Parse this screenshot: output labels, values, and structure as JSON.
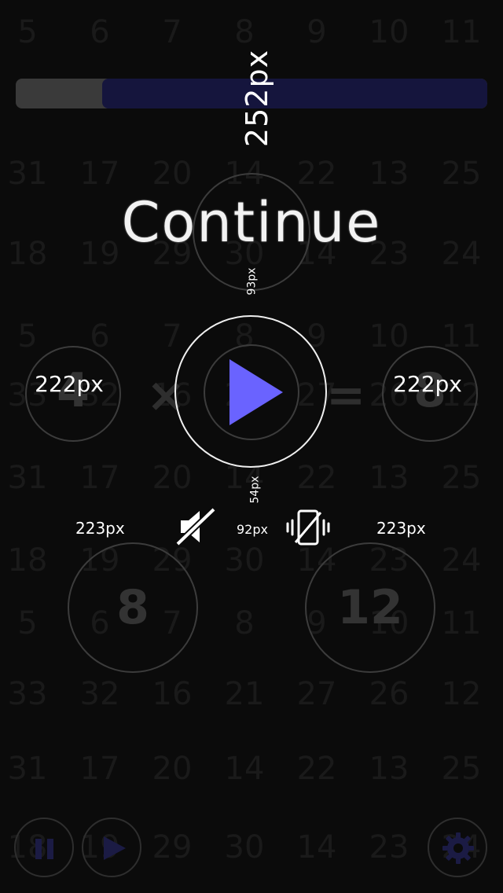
{
  "progress": {
    "fraction": 0.817
  },
  "labels": {
    "progress_px": "252px",
    "continue": "Continue",
    "top_circle_px": "93px",
    "left_circle_px": "222px",
    "right_circle_px": "222px",
    "play_below_px": "54px",
    "left_bottom_px": "223px",
    "right_bottom_px": "223px",
    "center_small_px": "92px"
  },
  "game": {
    "left_operand": "4",
    "operator": "×",
    "equals": "=",
    "right_result": "8",
    "option_left": "8",
    "option_right": "12"
  },
  "colors": {
    "accent": "#6a63ff",
    "progress_fill": "#15153d",
    "progress_track": "#3a3a3a",
    "background": "#0b0b0b",
    "bottom_icons": "#1b1b44"
  },
  "icons": {
    "mute": "speaker-muted-icon",
    "vibrate": "vibrate-off-icon",
    "play": "play-icon",
    "pause": "pause-icon",
    "settings": "gear-icon"
  },
  "background_grid": [
    [
      "5",
      "6",
      "7",
      "8",
      "9",
      "10",
      "11"
    ],
    [
      "31",
      "17",
      "20",
      "14",
      "22",
      "13",
      "25"
    ],
    [
      "18",
      "19",
      "29",
      "30",
      "14",
      "23",
      "24"
    ],
    [
      "5",
      "6",
      "7",
      "8",
      "9",
      "10",
      "11"
    ],
    [
      "33",
      "32",
      "16",
      "21",
      "27",
      "26",
      "12"
    ],
    [
      "31",
      "17",
      "20",
      "14",
      "22",
      "13",
      "25"
    ],
    [
      "18",
      "19",
      "29",
      "30",
      "14",
      "23",
      "24"
    ],
    [
      "5",
      "6",
      "7",
      "8",
      "9",
      "10",
      "11"
    ],
    [
      "33",
      "32",
      "16",
      "21",
      "27",
      "26",
      "12"
    ],
    [
      "31",
      "17",
      "20",
      "14",
      "22",
      "13",
      "25"
    ],
    [
      "18",
      "19",
      "29",
      "30",
      "14",
      "23",
      "24"
    ]
  ]
}
